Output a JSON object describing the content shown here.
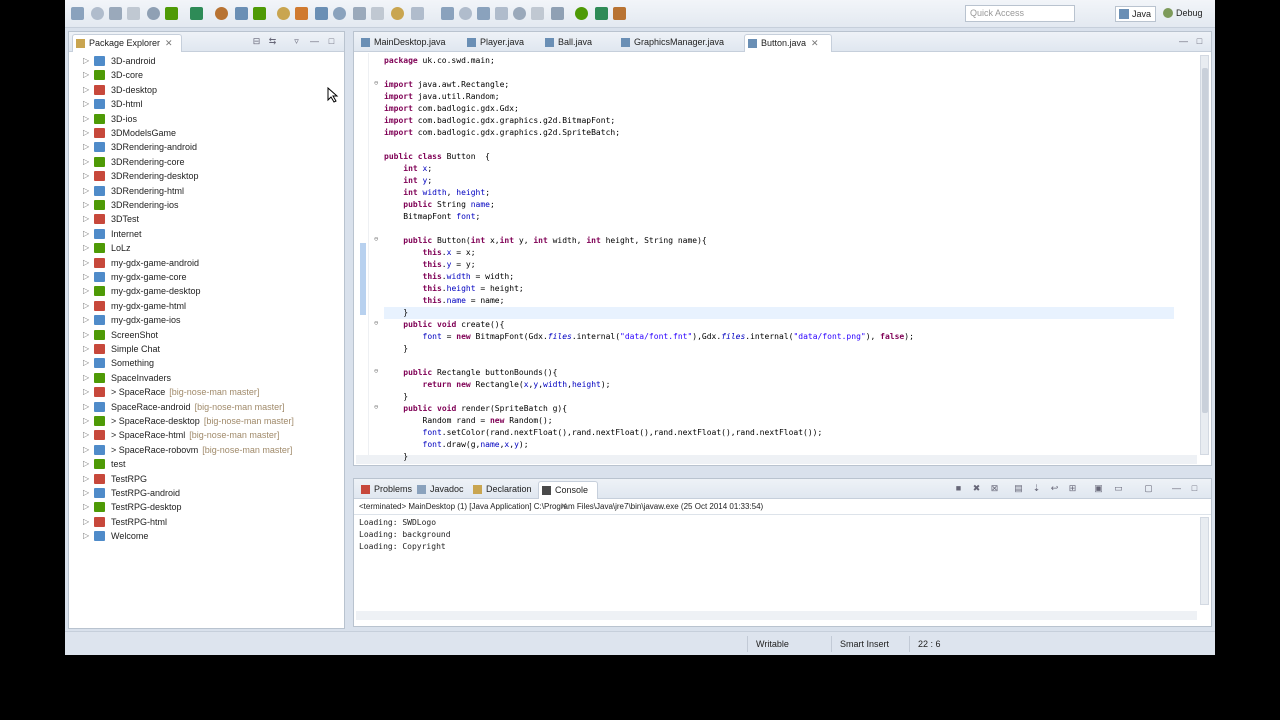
{
  "toolbar": {
    "quick_access_placeholder": "Quick Access",
    "perspectives": [
      {
        "label": "Java",
        "active": true
      },
      {
        "label": "Debug",
        "active": false
      }
    ]
  },
  "package_explorer": {
    "title": "Package Explorer",
    "items": [
      {
        "label": "3D-android",
        "git": ""
      },
      {
        "label": "3D-core",
        "git": ""
      },
      {
        "label": "3D-desktop",
        "git": ""
      },
      {
        "label": "3D-html",
        "git": ""
      },
      {
        "label": "3D-ios",
        "git": ""
      },
      {
        "label": "3DModelsGame",
        "git": ""
      },
      {
        "label": "3DRendering-android",
        "git": ""
      },
      {
        "label": "3DRendering-core",
        "git": ""
      },
      {
        "label": "3DRendering-desktop",
        "git": ""
      },
      {
        "label": "3DRendering-html",
        "git": ""
      },
      {
        "label": "3DRendering-ios",
        "git": ""
      },
      {
        "label": "3DTest",
        "git": ""
      },
      {
        "label": "Internet",
        "git": ""
      },
      {
        "label": "LoLz",
        "git": ""
      },
      {
        "label": "my-gdx-game-android",
        "git": ""
      },
      {
        "label": "my-gdx-game-core",
        "git": ""
      },
      {
        "label": "my-gdx-game-desktop",
        "git": ""
      },
      {
        "label": "my-gdx-game-html",
        "git": ""
      },
      {
        "label": "my-gdx-game-ios",
        "git": ""
      },
      {
        "label": "ScreenShot",
        "git": ""
      },
      {
        "label": "Simple Chat",
        "git": ""
      },
      {
        "label": "Something",
        "git": ""
      },
      {
        "label": "SpaceInvaders",
        "git": ""
      },
      {
        "label": "> SpaceRace",
        "git": "[big-nose-man master]"
      },
      {
        "label": "SpaceRace-android",
        "git": "[big-nose-man master]"
      },
      {
        "label": "> SpaceRace-desktop",
        "git": "[big-nose-man master]"
      },
      {
        "label": "> SpaceRace-html",
        "git": "[big-nose-man master]"
      },
      {
        "label": "> SpaceRace-robovm",
        "git": "[big-nose-man master]"
      },
      {
        "label": "test",
        "git": ""
      },
      {
        "label": "TestRPG",
        "git": ""
      },
      {
        "label": "TestRPG-android",
        "git": ""
      },
      {
        "label": "TestRPG-desktop",
        "git": ""
      },
      {
        "label": "TestRPG-html",
        "git": ""
      },
      {
        "label": "Welcome",
        "git": ""
      }
    ]
  },
  "editor": {
    "tabs": [
      {
        "label": "MainDesktop.java",
        "active": false
      },
      {
        "label": "Player.java",
        "active": false
      },
      {
        "label": "Ball.java",
        "active": false
      },
      {
        "label": "GraphicsManager.java",
        "active": false
      },
      {
        "label": "Button.java",
        "active": true
      }
    ],
    "lines": [
      "package uk.co.swd.main;",
      "",
      "import java.awt.Rectangle;",
      "import java.util.Random;",
      "import com.badlogic.gdx.Gdx;",
      "import com.badlogic.gdx.graphics.g2d.BitmapFont;",
      "import com.badlogic.gdx.graphics.g2d.SpriteBatch;",
      "",
      "public class Button  {",
      "    int x;",
      "    int y;",
      "    int width, height;",
      "    public String name;",
      "    BitmapFont font;",
      "",
      "    public Button(int x,int y, int width, int height, String name){",
      "        this.x = x;",
      "        this.y = y;",
      "        this.width = width;",
      "        this.height = height;",
      "        this.name = name;",
      "    }",
      "    public void create(){",
      "        font = new BitmapFont(Gdx.files.internal(\"data/font.fnt\"),Gdx.files.internal(\"data/font.png\"), false);",
      "    }",
      "",
      "    public Rectangle buttonBounds(){",
      "        return new Rectangle(x,y,width,height);",
      "    }",
      "    public void render(SpriteBatch g){",
      "        Random rand = new Random();",
      "        font.setColor(rand.nextFloat(),rand.nextFloat(),rand.nextFloat(),rand.nextFloat());",
      "        font.draw(g,name,x,y);",
      "    }"
    ]
  },
  "bottom": {
    "tabs": [
      {
        "label": "Problems",
        "active": false
      },
      {
        "label": "Javadoc",
        "active": false
      },
      {
        "label": "Declaration",
        "active": false
      },
      {
        "label": "Console",
        "active": true
      }
    ],
    "header": "<terminated> MainDesktop (1) [Java Application] C:\\Program Files\\Java\\jre7\\bin\\javaw.exe (25 Oct 2014 01:33:54)",
    "output": [
      "Loading: SWDLogo",
      "Loading: background",
      "Loading: Copyright"
    ]
  },
  "status": {
    "writable": "Writable",
    "insert_mode": "Smart Insert",
    "position": "22 : 6"
  },
  "colors": {
    "keyword": "#7f0055",
    "field": "#0000c0",
    "string": "#2a00ff",
    "chrome": "#d9e1ec"
  }
}
